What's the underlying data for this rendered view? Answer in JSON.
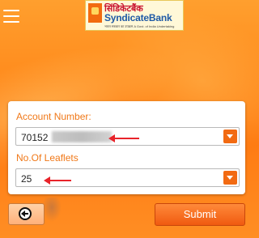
{
  "header": {
    "menu_icon": "hamburger-menu-icon",
    "logo": {
      "hindi_text": "सिंडिकेटबैंक",
      "name": "SyndicateBank",
      "tagline": "भारत सरकार का उपक्रम   A Govt. of India Undertaking"
    }
  },
  "form": {
    "account_number": {
      "label": "Account Number:",
      "value": "70152"
    },
    "leaflets": {
      "label": "No.Of Leaflets",
      "value": "25"
    }
  },
  "buttons": {
    "back_icon": "arrow-left-circle-icon",
    "submit_label": "Submit"
  },
  "colors": {
    "accent": "#f26a12",
    "label": "#f07818",
    "annotation_arrow": "#e8232a"
  }
}
